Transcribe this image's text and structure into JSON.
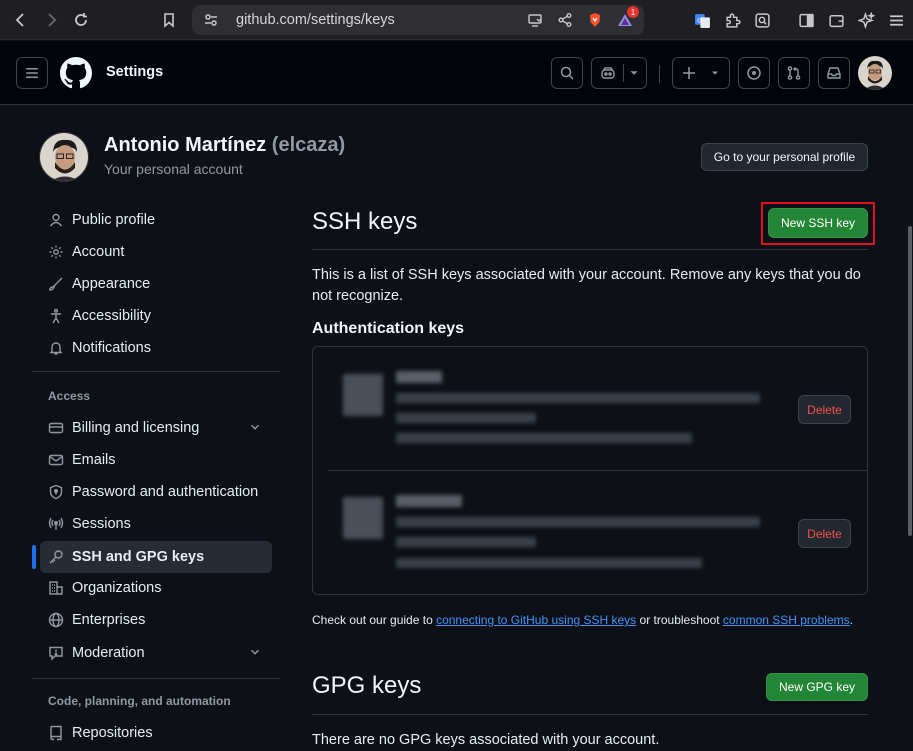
{
  "browser": {
    "url": "github.com/settings/keys",
    "brave_badge": "1"
  },
  "header": {
    "title": "Settings"
  },
  "profile": {
    "name": "Antonio Martínez",
    "handle": "(elcaza)",
    "subtitle": "Your personal account",
    "go_profile_label": "Go to your personal profile"
  },
  "sidebar": {
    "items_top": [
      {
        "label": "Public profile",
        "icon": "person-icon"
      },
      {
        "label": "Account",
        "icon": "gear-icon"
      },
      {
        "label": "Appearance",
        "icon": "paintbrush-icon"
      },
      {
        "label": "Accessibility",
        "icon": "accessibility-icon"
      },
      {
        "label": "Notifications",
        "icon": "bell-icon"
      }
    ],
    "access_section": "Access",
    "items_access": [
      {
        "label": "Billing and licensing",
        "icon": "credit-card-icon"
      },
      {
        "label": "Emails",
        "icon": "mail-icon"
      },
      {
        "label": "Password and authentication",
        "icon": "shield-lock-icon"
      },
      {
        "label": "Sessions",
        "icon": "broadcast-icon"
      },
      {
        "label": "SSH and GPG keys",
        "icon": "key-icon"
      },
      {
        "label": "Organizations",
        "icon": "organization-icon"
      },
      {
        "label": "Enterprises",
        "icon": "globe-icon"
      },
      {
        "label": "Moderation",
        "icon": "report-icon"
      }
    ],
    "code_section": "Code, planning, and automation",
    "items_code": [
      {
        "label": "Repositories",
        "icon": "repo-icon"
      }
    ]
  },
  "main": {
    "ssh_title": "SSH keys",
    "new_ssh_label": "New SSH key",
    "ssh_description": "This is a list of SSH keys associated with your account. Remove any keys that you do not recognize.",
    "auth_keys_title": "Authentication keys",
    "delete_label": "Delete",
    "guide_prefix": "Check out our guide to ",
    "guide_link1": "connecting to GitHub using SSH keys",
    "guide_middle": " or troubleshoot ",
    "guide_link2": "common SSH problems",
    "guide_suffix": ".",
    "gpg_title": "GPG keys",
    "new_gpg_label": "New GPG key",
    "gpg_empty": "There are no GPG keys associated with your account."
  },
  "colors": {
    "accent": "#238636",
    "link": "#4493f8",
    "danger": "#f85149",
    "highlight": "#e0111b"
  }
}
